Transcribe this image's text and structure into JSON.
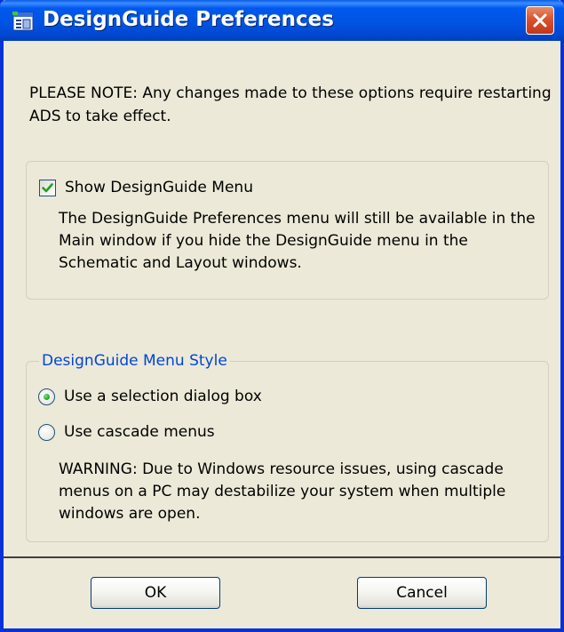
{
  "window": {
    "title": "DesignGuide Preferences",
    "close_icon": "close-icon",
    "app_icon": "designguide-app-icon"
  },
  "note": {
    "text": "PLEASE NOTE: Any changes made to these options require restarting ADS to take effect."
  },
  "show_menu": {
    "label": "Show DesignGuide Menu",
    "checked": true,
    "description": "The DesignGuide Preferences menu will still be available in the Main window if you hide the DesignGuide menu in the Schematic and Layout windows."
  },
  "menu_style": {
    "legend": "DesignGuide Menu Style",
    "options": [
      {
        "label": "Use a selection dialog box",
        "selected": true
      },
      {
        "label": "Use cascade menus",
        "selected": false
      }
    ],
    "warning": "WARNING: Due to Windows resource issues, using cascade menus on a PC may destabilize your system when multiple windows are open."
  },
  "buttons": {
    "ok": "OK",
    "cancel": "Cancel"
  },
  "colors": {
    "titlebar": "#0054e3",
    "dialog_bg": "#ece9d8",
    "legend_text": "#0046d5",
    "close_button": "#d9532f",
    "check_mark": "#21a121"
  }
}
